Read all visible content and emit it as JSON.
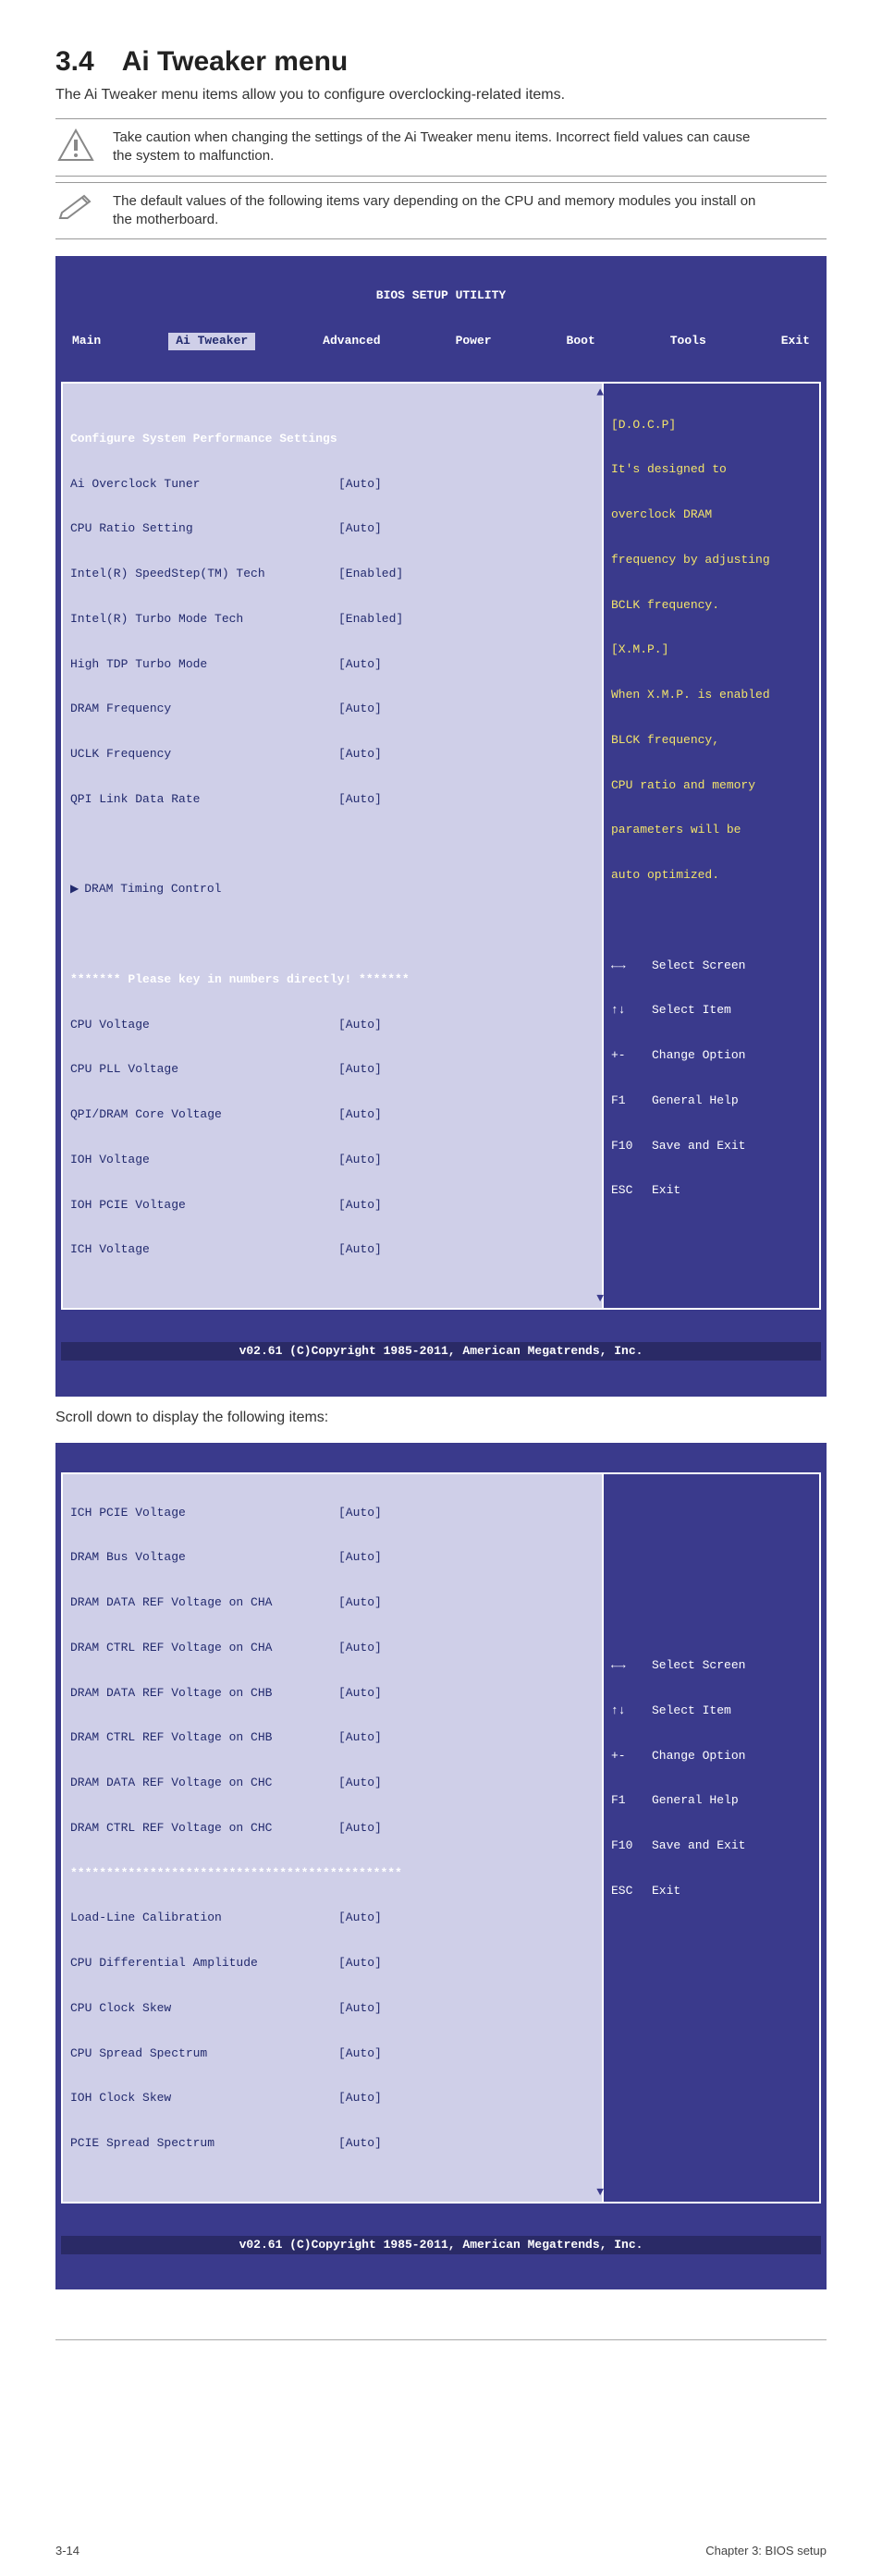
{
  "page": {
    "heading": "3.4 Ai Tweaker menu",
    "intro": "The Ai Tweaker menu items allow you to configure overclocking-related items.",
    "note1": "Take caution when changing the settings of the Ai Tweaker menu items. Incorrect field values can cause the system to malfunction.",
    "note2": "The default values of the following items vary depending on the CPU and memory modules you install on the motherboard.",
    "scroll_note": "Scroll down to display the following items:",
    "footer_left": "3-14",
    "footer_right": "Chapter 3: BIOS setup"
  },
  "bios1": {
    "title": "BIOS SETUP UTILITY",
    "menu": [
      "Main",
      "Ai Tweaker",
      "Advanced",
      "Power",
      "Boot",
      "Tools",
      "Exit"
    ],
    "active": "Ai Tweaker",
    "heading": "Configure System Performance Settings",
    "rows": [
      {
        "lbl": "Ai Overclock Tuner",
        "val": "[Auto]"
      },
      {
        "lbl": "CPU Ratio Setting",
        "val": "[Auto]"
      },
      {
        "lbl": "Intel(R) SpeedStep(TM) Tech",
        "val": "[Enabled]"
      },
      {
        "lbl": "Intel(R) Turbo Mode Tech",
        "val": "[Enabled]"
      },
      {
        "lbl": "High TDP Turbo Mode",
        "val": "[Auto]"
      },
      {
        "lbl": "DRAM Frequency",
        "val": "[Auto]"
      },
      {
        "lbl": "UCLK Frequency",
        "val": "[Auto]"
      },
      {
        "lbl": "QPI Link Data Rate",
        "val": "[Auto]"
      }
    ],
    "dram": "DRAM Timing Control",
    "divider": "******* Please key in numbers directly! *******",
    "rows2": [
      {
        "lbl": "CPU Voltage",
        "val": "[Auto]"
      },
      {
        "lbl": "CPU PLL Voltage",
        "val": "[Auto]"
      },
      {
        "lbl": "QPI/DRAM Core Voltage",
        "val": "[Auto]"
      },
      {
        "lbl": "IOH Voltage",
        "val": "[Auto]"
      },
      {
        "lbl": "IOH PCIE Voltage",
        "val": "[Auto]"
      },
      {
        "lbl": "ICH Voltage",
        "val": "[Auto]"
      }
    ],
    "help_top": [
      "[D.O.C.P]",
      "It's designed to",
      "overclock DRAM",
      "frequency by adjusting",
      "BCLK frequency.",
      "[X.M.P.]",
      "When X.M.P. is enabled",
      "BLCK frequency,",
      "CPU ratio and memory",
      "parameters will be",
      "auto optimized."
    ],
    "nav": [
      {
        "k": "←→",
        "v": "Select Screen"
      },
      {
        "k": "↑↓",
        "v": "Select Item"
      },
      {
        "k": "+-",
        "v": "Change Option"
      },
      {
        "k": "F1",
        "v": "General Help"
      },
      {
        "k": "F10",
        "v": "Save and Exit"
      },
      {
        "k": "ESC",
        "v": "Exit"
      }
    ],
    "footer": "v02.61 (C)Copyright 1985-2011, American Megatrends, Inc."
  },
  "bios2": {
    "rows": [
      {
        "lbl": "ICH PCIE Voltage",
        "val": "[Auto]"
      },
      {
        "lbl": "DRAM Bus Voltage",
        "val": "[Auto]"
      },
      {
        "lbl": "DRAM DATA REF Voltage on CHA",
        "val": "[Auto]"
      },
      {
        "lbl": "DRAM CTRL REF Voltage on CHA",
        "val": "[Auto]"
      },
      {
        "lbl": "DRAM DATA REF Voltage on CHB",
        "val": "[Auto]"
      },
      {
        "lbl": "DRAM CTRL REF Voltage on CHB",
        "val": "[Auto]"
      },
      {
        "lbl": "DRAM DATA REF Voltage on CHC",
        "val": "[Auto]"
      },
      {
        "lbl": "DRAM CTRL REF Voltage on CHC",
        "val": "[Auto]"
      }
    ],
    "divider": "**********************************************",
    "rows2": [
      {
        "lbl": "Load-Line Calibration",
        "val": "[Auto]"
      },
      {
        "lbl": "CPU Differential Amplitude",
        "val": "[Auto]"
      },
      {
        "lbl": "CPU Clock Skew",
        "val": "[Auto]"
      },
      {
        "lbl": "CPU Spread Spectrum",
        "val": "[Auto]"
      },
      {
        "lbl": "IOH Clock Skew",
        "val": "[Auto]"
      },
      {
        "lbl": "PCIE Spread Spectrum",
        "val": "[Auto]"
      }
    ],
    "nav": [
      {
        "k": "←→",
        "v": "Select Screen"
      },
      {
        "k": "↑↓",
        "v": "Select Item"
      },
      {
        "k": "+-",
        "v": "Change Option"
      },
      {
        "k": "F1",
        "v": "General Help"
      },
      {
        "k": "F10",
        "v": "Save and Exit"
      },
      {
        "k": "ESC",
        "v": "Exit"
      }
    ],
    "footer": "v02.61 (C)Copyright 1985-2011, American Megatrends, Inc."
  }
}
